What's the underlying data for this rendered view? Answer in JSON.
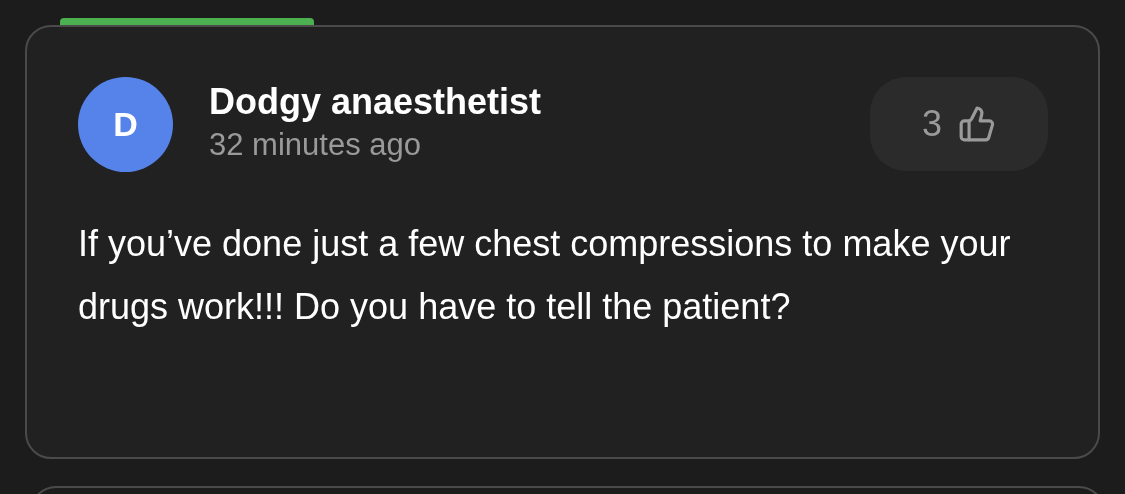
{
  "comment": {
    "avatar_letter": "D",
    "author": "Dodgy anaesthetist",
    "time": "32 minutes ago",
    "likes": "3",
    "body": "If you’ve done just a few chest compressions to make your drugs work!!! Do you have to tell the patient?"
  }
}
